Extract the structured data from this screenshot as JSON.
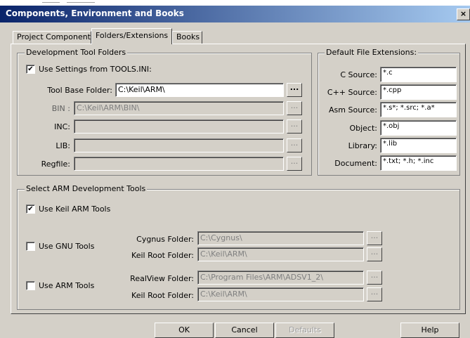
{
  "window": {
    "title": "Components, Environment and Books",
    "close_glyph": "×"
  },
  "tabs": [
    {
      "label": "Project Components"
    },
    {
      "label": "Folders/Extensions"
    },
    {
      "label": "Books"
    }
  ],
  "dev_tool_folders": {
    "group_label": "Development Tool Folders",
    "use_settings": {
      "label": "Use Settings from TOOLS.INI:",
      "checked": true,
      "mark": "✔"
    },
    "fields": [
      {
        "label": "Tool Base Folder:",
        "value": "C:\\Keil\\ARM\\",
        "enabled": true
      },
      {
        "label": "BIN :",
        "value": "C:\\Keil\\ARM\\BIN\\",
        "enabled": false
      },
      {
        "label": "INC:",
        "value": "",
        "enabled": false
      },
      {
        "label": "LIB:",
        "value": "",
        "enabled": false
      },
      {
        "label": "Regfile:",
        "value": "",
        "enabled": false
      }
    ],
    "browse_label": "..."
  },
  "file_extensions": {
    "group_label": "Default File Extensions:",
    "items": [
      {
        "label": "C Source:",
        "value": "*.c"
      },
      {
        "label": "C++ Source:",
        "value": "*.cpp"
      },
      {
        "label": "Asm Source:",
        "value": "*.s*; *.src; *.a*"
      },
      {
        "label": "Object:",
        "value": "*.obj"
      },
      {
        "label": "Library:",
        "value": "*.lib"
      },
      {
        "label": "Document:",
        "value": "*.txt; *.h; *.inc"
      }
    ]
  },
  "arm_tools": {
    "group_label": "Select ARM Development Tools",
    "keil": {
      "label": "Use Keil ARM Tools",
      "checked": true,
      "mark": "✔"
    },
    "gnu": {
      "label": "Use GNU Tools",
      "checked": false,
      "fields": [
        {
          "label": "Cygnus Folder:",
          "value": "C:\\Cygnus\\"
        },
        {
          "label": "Keil Root Folder:",
          "value": "C:\\Keil\\ARM\\"
        }
      ]
    },
    "arm": {
      "label": "Use ARM Tools",
      "checked": false,
      "fields": [
        {
          "label": "RealView Folder:",
          "value": "C:\\Program Files\\ARM\\ADSV1_2\\"
        },
        {
          "label": "Keil Root Folder:",
          "value": "C:\\Keil\\ARM\\"
        }
      ]
    },
    "browse_label": "..."
  },
  "buttons": {
    "ok": "OK",
    "cancel": "Cancel",
    "defaults": "Defaults",
    "help": "Help"
  }
}
